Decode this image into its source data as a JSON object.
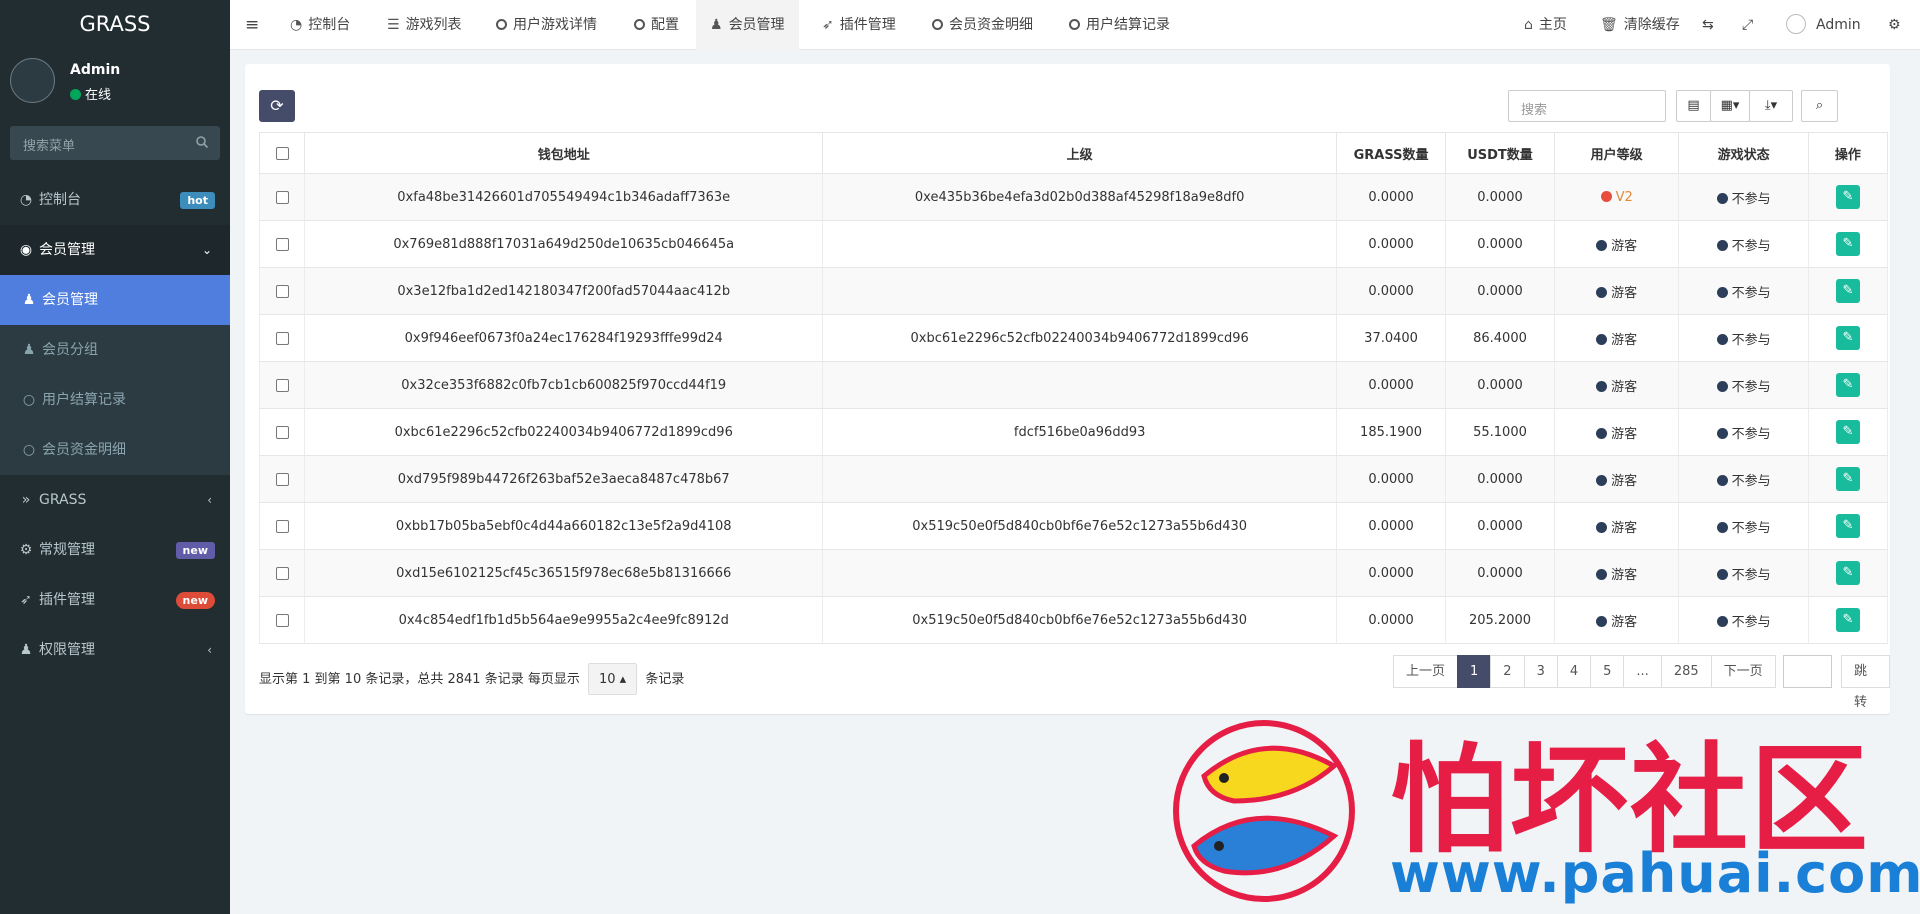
{
  "app": {
    "brand": "GRASS"
  },
  "user": {
    "name": "Admin",
    "status": "在线",
    "status_color": "#00a65a"
  },
  "sidebar": {
    "search_placeholder": "搜索菜单",
    "items": [
      {
        "label": "控制台",
        "icon": "dashboard-icon",
        "badge": "hot",
        "badge_color": "#3c8dbc"
      },
      {
        "label": "会员管理",
        "icon": "user-circle-icon"
      },
      {
        "label": "会员管理",
        "icon": "user-icon"
      },
      {
        "label": "会员分组",
        "icon": "users-icon"
      },
      {
        "label": "用户结算记录",
        "icon": "circle-icon"
      },
      {
        "label": "会员资金明细",
        "icon": "circle-icon"
      },
      {
        "label": "GRASS",
        "icon": "angle-double-right-icon"
      },
      {
        "label": "常规管理",
        "icon": "cogs-icon",
        "badge": "new",
        "badge_color": "#605ca8"
      },
      {
        "label": "插件管理",
        "icon": "rocket-icon",
        "badge": "new",
        "badge_color": "#dd4b39"
      },
      {
        "label": "权限管理",
        "icon": "group-icon"
      }
    ]
  },
  "topnav": {
    "tabs": [
      "控制台",
      "游戏列表",
      "用户游戏详情",
      "配置",
      "会员管理",
      "插件管理",
      "会员资金明细",
      "用户结算记录"
    ],
    "right": {
      "home": "主页",
      "clear_cache": "清除缓存",
      "user": "Admin"
    }
  },
  "toolbar": {
    "search_placeholder": "搜索"
  },
  "table": {
    "columns": [
      "钱包地址",
      "上级",
      "GRASS数量",
      "USDT数量",
      "用户等级",
      "游戏状态",
      "操作"
    ],
    "rows": [
      {
        "wallet": "0xfa48be31426601d705549494c1b346adaff7363e",
        "parent": "0xe435b36be4efa3d02b0d388af45298f18a9e8df0",
        "grass": "0.0000",
        "usdt": "0.0000",
        "level": "V2",
        "status": "不参与"
      },
      {
        "wallet": "0x769e81d888f17031a649d250de10635cb046645a",
        "parent": "",
        "grass": "0.0000",
        "usdt": "0.0000",
        "level": "游客",
        "status": "不参与"
      },
      {
        "wallet": "0x3e12fba1d2ed142180347f200fad57044aac412b",
        "parent": "",
        "grass": "0.0000",
        "usdt": "0.0000",
        "level": "游客",
        "status": "不参与"
      },
      {
        "wallet": "0x9f946eef0673f0a24ec176284f19293fffe99d24",
        "parent": "0xbc61e2296c52cfb02240034b9406772d1899cd96",
        "grass": "37.0400",
        "usdt": "86.4000",
        "level": "游客",
        "status": "不参与"
      },
      {
        "wallet": "0x32ce353f6882c0fb7cb1cb600825f970ccd44f19",
        "parent": "",
        "grass": "0.0000",
        "usdt": "0.0000",
        "level": "游客",
        "status": "不参与"
      },
      {
        "wallet": "0xbc61e2296c52cfb02240034b9406772d1899cd96",
        "parent": "fdcf516be0a96dd93",
        "grass": "185.1900",
        "usdt": "55.1000",
        "level": "游客",
        "status": "不参与"
      },
      {
        "wallet": "0xd795f989b44726f263baf52e3aeca8487c478b67",
        "parent": "",
        "grass": "0.0000",
        "usdt": "0.0000",
        "level": "游客",
        "status": "不参与"
      },
      {
        "wallet": "0xbb17b05ba5ebf0c4d44a660182c13e5f2a9d4108",
        "parent": "0x519c50e0f5d840cb0bf6e76e52c1273a55b6d430",
        "grass": "0.0000",
        "usdt": "0.0000",
        "level": "游客",
        "status": "不参与"
      },
      {
        "wallet": "0xd15e6102125cf45c36515f978ec68e5b81316666",
        "parent": "",
        "grass": "0.0000",
        "usdt": "0.0000",
        "level": "游客",
        "status": "不参与"
      },
      {
        "wallet": "0x4c854edf1fb1d5b564ae9e9955a2c4ee9fc8912d",
        "parent": "0x519c50e0f5d840cb0bf6e76e52c1273a55b6d430",
        "grass": "0.0000",
        "usdt": "205.2000",
        "level": "游客",
        "status": "不参与"
      }
    ]
  },
  "footer": {
    "summary_prefix": "显示第 1 到第 10 条记录，总共 2841 条记录 每页显示",
    "page_size": "10",
    "summary_suffix": "条记录"
  },
  "pagination": {
    "prev": "上一页",
    "pages": [
      "1",
      "2",
      "3",
      "4",
      "5",
      "...",
      "285"
    ],
    "next": "下一页",
    "jump": "跳转"
  },
  "watermark": {
    "text": "怕坏社区",
    "url": "www.pahuai.com"
  },
  "colors": {
    "v2": "#e74c3c",
    "guest": "#2c3e5a",
    "status": "#2c3e5a",
    "edit": "#18bc9c",
    "active_menu": "#4f7ede"
  }
}
